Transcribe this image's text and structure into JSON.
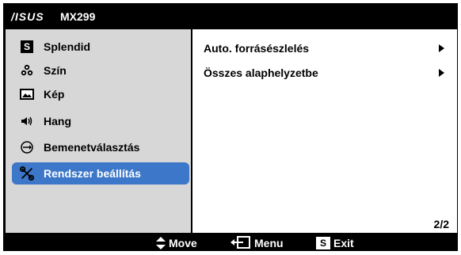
{
  "header": {
    "brand": "/ISUS",
    "model": "MX299"
  },
  "sidebar": {
    "items": [
      {
        "label": "Splendid",
        "icon": "s-badge-icon"
      },
      {
        "label": "Szín",
        "icon": "color-icon"
      },
      {
        "label": "Kép",
        "icon": "image-icon"
      },
      {
        "label": "Hang",
        "icon": "speaker-icon"
      },
      {
        "label": "Bemenetválasztás",
        "icon": "input-select-icon"
      },
      {
        "label": "Rendszer beállítás",
        "icon": "system-setup-icon",
        "selected": true
      }
    ]
  },
  "content": {
    "options": [
      {
        "label": "Auto. forrásészlelés",
        "has_submenu": true
      },
      {
        "label": "Összes alaphelyzetbe",
        "has_submenu": true
      }
    ],
    "page_indicator": "2/2"
  },
  "footer": {
    "move": "Move",
    "menu": "Menu",
    "exit": "Exit",
    "exit_key": "S"
  },
  "colors": {
    "osd_background": "#000000",
    "sidebar_background": "#d7d7d7",
    "selected_highlight": "#3d77c9",
    "content_background": "#ffffff"
  }
}
